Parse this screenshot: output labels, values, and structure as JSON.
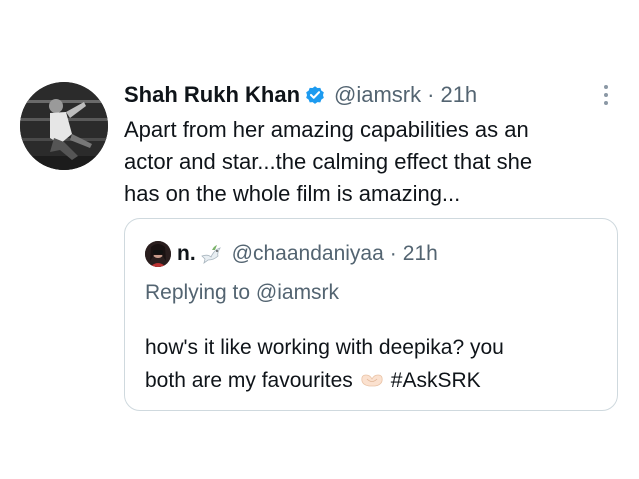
{
  "tweet": {
    "author_name": "Shah Rukh Khan",
    "author_handle": "@iamsrk",
    "separator": "·",
    "time": "21h",
    "text_lines": [
      "Apart from her amazing capabilities as an",
      "actor and star...the calming effect that she",
      "has on the whole film is amazing..."
    ],
    "verified_icon": "verified-badge-icon",
    "more_icon": "more-vertical-icon",
    "colors": {
      "text": "#0f1419",
      "secondary": "#536471",
      "verified": "#1d9bf0",
      "border": "#cfd9de"
    }
  },
  "quote": {
    "author_name": "n.",
    "author_handle": "@chaandaniyaa",
    "separator": "·",
    "time": "21h",
    "replying_prefix": "Replying to",
    "replying_handle": "@iamsrk",
    "text_line1": "how's it like working with deepika? you",
    "text_line2_prefix": "both are my favourites",
    "text_line2_hashtag": "#AskSRK",
    "emoji_icon": "heart-hands-icon",
    "name_emoji_icon": "dove-icon"
  }
}
